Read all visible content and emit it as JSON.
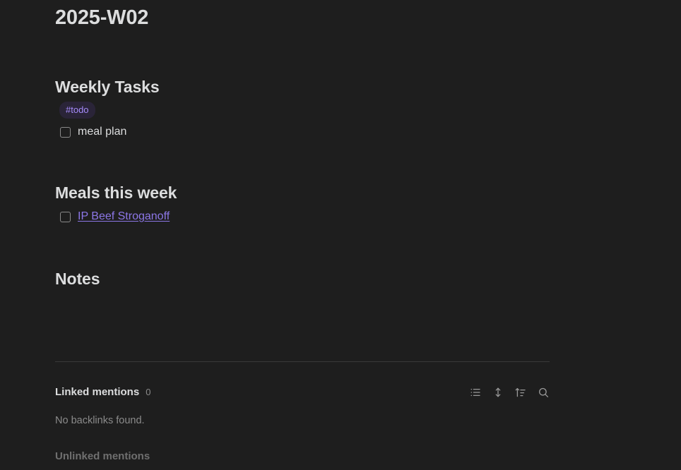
{
  "note": {
    "title": "2025-W02"
  },
  "sections": {
    "weekly_tasks": {
      "heading": "Weekly Tasks",
      "tag": "#todo",
      "tasks": [
        {
          "label": "meal plan",
          "checked": false
        }
      ]
    },
    "meals_this_week": {
      "heading": "Meals this week",
      "items": [
        {
          "label": "IP Beef Stroganoff",
          "checked": false,
          "is_link": true
        }
      ]
    },
    "notes": {
      "heading": "Notes",
      "body": ""
    }
  },
  "backlinks": {
    "linked_mentions_label": "Linked mentions",
    "linked_mentions_count": "0",
    "empty_message": "No backlinks found.",
    "unlinked_mentions_label": "Unlinked mentions",
    "icons": [
      {
        "name": "list-icon",
        "title": "Collapse results"
      },
      {
        "name": "expand-collapse-icon",
        "title": "Expand results"
      },
      {
        "name": "sort-ascending-icon",
        "title": "Change sort order"
      },
      {
        "name": "search-icon",
        "title": "Search"
      }
    ]
  },
  "colors": {
    "background": "#1e1e1e",
    "text": "#dcddde",
    "muted": "#8b8b8b",
    "link": "#8d77e8",
    "tag_text": "#a68bfa",
    "tag_bg": "#2a2438",
    "divider": "#3a3a3a"
  }
}
